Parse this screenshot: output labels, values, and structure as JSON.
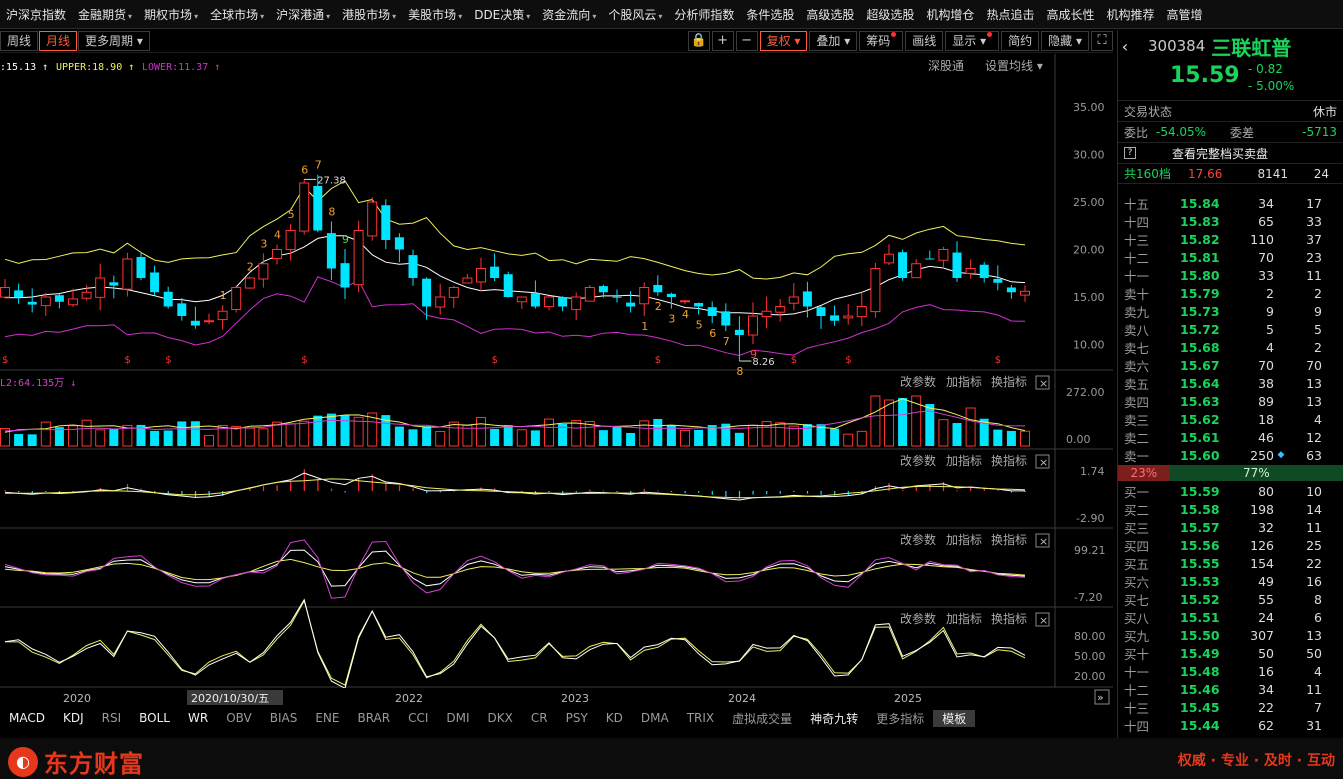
{
  "top_menu": [
    {
      "label": "沪深京指数",
      "caret": false
    },
    {
      "label": "金融期货",
      "caret": true
    },
    {
      "label": "期权市场",
      "caret": true
    },
    {
      "label": "全球市场",
      "caret": true
    },
    {
      "label": "沪深港通",
      "caret": true
    },
    {
      "label": "港股市场",
      "caret": true
    },
    {
      "label": "美股市场",
      "caret": true
    },
    {
      "label": "DDE决策",
      "caret": true
    },
    {
      "label": "资金流向",
      "caret": true
    },
    {
      "label": "个股风云",
      "caret": true
    },
    {
      "label": "分析师指数",
      "caret": false
    },
    {
      "label": "条件选股",
      "caret": false
    },
    {
      "label": "高级选股",
      "caret": false
    },
    {
      "label": "超级选股",
      "caret": false
    },
    {
      "label": "机构增仓",
      "caret": false
    },
    {
      "label": "热点追击",
      "caret": false
    },
    {
      "label": "高成长性",
      "caret": false
    },
    {
      "label": "机构推荐",
      "caret": false
    },
    {
      "label": "高管增",
      "caret": false
    }
  ],
  "toolbar": {
    "periods": [
      {
        "label": "周线",
        "active": false
      },
      {
        "label": "月线",
        "active": true
      },
      {
        "label": "更多周期",
        "active": false,
        "caret": true
      }
    ],
    "buttons": [
      {
        "id": "lock",
        "label": "🔒",
        "icon": "lock-icon"
      },
      {
        "id": "zoom-in",
        "label": "+",
        "icon": "plus-icon"
      },
      {
        "id": "zoom-out",
        "label": "−",
        "icon": "minus-icon"
      },
      {
        "id": "fuquan",
        "label": "复权",
        "caret": true,
        "hot": true
      },
      {
        "id": "diejia",
        "label": "叠加",
        "caret": true
      },
      {
        "id": "chouma",
        "label": "筹码",
        "dot": true
      },
      {
        "id": "huaxian",
        "label": "画线"
      },
      {
        "id": "xianshi",
        "label": "显示",
        "caret": true,
        "dot": true
      },
      {
        "id": "jianyue",
        "label": "简约"
      },
      {
        "id": "yincang",
        "label": "隐藏",
        "caret": true
      },
      {
        "id": "fullscreen",
        "label": "⛶",
        "icon": "fullscreen-icon"
      }
    ]
  },
  "main_chart": {
    "legend": {
      "mid": ":15.13",
      "upper": "UPPER:18.90",
      "lower": "LOWER:11.37"
    },
    "links": {
      "shengutong": "深股通",
      "ma_settings": "设置均线"
    },
    "ylabels": [
      "35.00",
      "30.00",
      "25.00",
      "20.00",
      "15.00",
      "10.00"
    ],
    "high_label": "27.38",
    "low_label": "8.26"
  },
  "sub_panels": {
    "vol": {
      "legend": "L2:64.135万",
      "ymax": "272.00",
      "ymin": "0.00"
    },
    "macd": {
      "ymax": "1.74",
      "ymin": "-2.90"
    },
    "kdj": {
      "ymax": "99.21",
      "ymin": "-7.20"
    },
    "p4": {
      "y1": "80.00",
      "y2": "50.00",
      "y3": "20.00"
    },
    "panel_actions": {
      "params": "改参数",
      "add": "加指标",
      "swap": "换指标"
    }
  },
  "xaxis": {
    "labels": [
      "2020",
      "2022",
      "2023",
      "2024",
      "2025"
    ],
    "cursor": "2020/10/30/五"
  },
  "indicator_tabs": [
    {
      "label": "MACD",
      "bright": true
    },
    {
      "label": "KDJ",
      "bright": true
    },
    {
      "label": "RSI"
    },
    {
      "label": "BOLL",
      "bright": true
    },
    {
      "label": "WR",
      "bright": true
    },
    {
      "label": "OBV"
    },
    {
      "label": "BIAS"
    },
    {
      "label": "ENE"
    },
    {
      "label": "BRAR"
    },
    {
      "label": "CCI"
    },
    {
      "label": "DMI"
    },
    {
      "label": "DKX"
    },
    {
      "label": "CR"
    },
    {
      "label": "PSY"
    },
    {
      "label": "KD"
    },
    {
      "label": "DMA"
    },
    {
      "label": "TRIX"
    },
    {
      "label": "虚拟成交量"
    },
    {
      "label": "神奇九转",
      "bright": true
    },
    {
      "label": "更多指标"
    },
    {
      "label": "模板",
      "sel": true
    }
  ],
  "footer": {
    "brand": "东方财富",
    "slogan": "权威 · 专业 · 及时 · 互动"
  },
  "quote": {
    "code": "300384",
    "name": "三联虹普",
    "price": "15.59",
    "change": "- 0.82",
    "change_pct": "- 5.00%",
    "trade_state_label": "交易状态",
    "trade_state": "休市",
    "weibi_label": "委比",
    "weibi": "-54.05%",
    "weicha_label": "委差",
    "weicha": "-5713",
    "full_book": "查看完整档买卖盘",
    "total_label": "共160档",
    "total_price": "17.66",
    "total_vol": "8141",
    "total_cnt": "24",
    "ratio_sell": "23%",
    "ratio_buy": "77%"
  },
  "asks": [
    {
      "label": "十五",
      "price": "15.84",
      "vol": "34",
      "cnt": "17"
    },
    {
      "label": "十四",
      "price": "15.83",
      "vol": "65",
      "cnt": "33"
    },
    {
      "label": "十三",
      "price": "15.82",
      "vol": "110",
      "cnt": "37"
    },
    {
      "label": "十二",
      "price": "15.81",
      "vol": "70",
      "cnt": "23"
    },
    {
      "label": "十一",
      "price": "15.80",
      "vol": "33",
      "cnt": "11"
    },
    {
      "label": "卖十",
      "price": "15.79",
      "vol": "2",
      "cnt": "2"
    },
    {
      "label": "卖九",
      "price": "15.73",
      "vol": "9",
      "cnt": "9"
    },
    {
      "label": "卖八",
      "price": "15.72",
      "vol": "5",
      "cnt": "5"
    },
    {
      "label": "卖七",
      "price": "15.68",
      "vol": "4",
      "cnt": "2"
    },
    {
      "label": "卖六",
      "price": "15.67",
      "vol": "70",
      "cnt": "70"
    },
    {
      "label": "卖五",
      "price": "15.64",
      "vol": "38",
      "cnt": "13"
    },
    {
      "label": "卖四",
      "price": "15.63",
      "vol": "89",
      "cnt": "13"
    },
    {
      "label": "卖三",
      "price": "15.62",
      "vol": "18",
      "cnt": "4"
    },
    {
      "label": "卖二",
      "price": "15.61",
      "vol": "46",
      "cnt": "12"
    },
    {
      "label": "卖一",
      "price": "15.60",
      "vol": "250",
      "cnt": "63",
      "dot": true
    }
  ],
  "bids": [
    {
      "label": "买一",
      "price": "15.59",
      "vol": "80",
      "cnt": "10"
    },
    {
      "label": "买二",
      "price": "15.58",
      "vol": "198",
      "cnt": "14"
    },
    {
      "label": "买三",
      "price": "15.57",
      "vol": "32",
      "cnt": "11"
    },
    {
      "label": "买四",
      "price": "15.56",
      "vol": "126",
      "cnt": "25"
    },
    {
      "label": "买五",
      "price": "15.55",
      "vol": "154",
      "cnt": "22"
    },
    {
      "label": "买六",
      "price": "15.53",
      "vol": "49",
      "cnt": "16"
    },
    {
      "label": "买七",
      "price": "15.52",
      "vol": "55",
      "cnt": "8"
    },
    {
      "label": "买八",
      "price": "15.51",
      "vol": "24",
      "cnt": "6"
    },
    {
      "label": "买九",
      "price": "15.50",
      "vol": "307",
      "cnt": "13"
    },
    {
      "label": "买十",
      "price": "15.49",
      "vol": "50",
      "cnt": "50"
    },
    {
      "label": "十一",
      "price": "15.48",
      "vol": "16",
      "cnt": "4"
    },
    {
      "label": "十二",
      "price": "15.46",
      "vol": "34",
      "cnt": "11"
    },
    {
      "label": "十三",
      "price": "15.45",
      "vol": "22",
      "cnt": "7"
    },
    {
      "label": "十四",
      "price": "15.44",
      "vol": "62",
      "cnt": "31"
    }
  ],
  "colors": {
    "up": "#ff3232",
    "down": "#00e5ff",
    "mid_line": "#ffffff",
    "upper_line": "#f0f060",
    "lower_line": "#d030d0",
    "price_down": "#19d45a"
  }
}
